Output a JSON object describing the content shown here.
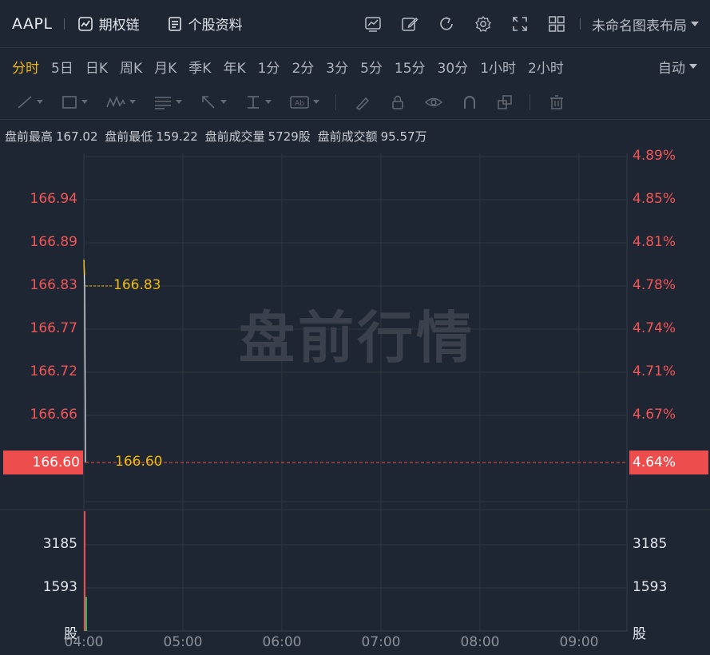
{
  "header": {
    "symbol": "AAPL",
    "options_chain": "期权链",
    "stock_profile": "个股资料",
    "layout_name": "未命名图表布局"
  },
  "periods": [
    "分时",
    "5日",
    "日K",
    "周K",
    "月K",
    "季K",
    "年K",
    "1分",
    "2分",
    "3分",
    "5分",
    "15分",
    "30分",
    "1小时",
    "2小时"
  ],
  "active_period": "分时",
  "auto_label": "自动",
  "premarket": {
    "high_label": "盘前最高",
    "high": "167.02",
    "low_label": "盘前最低",
    "low": "159.22",
    "vol_label": "盘前成交量",
    "vol": "5729股",
    "amt_label": "盘前成交额",
    "amt": "95.57万"
  },
  "watermark": "盘前行情",
  "price_axis": [
    "166.94",
    "166.89",
    "166.83",
    "166.77",
    "166.72",
    "166.66"
  ],
  "pct_axis": [
    "4.89%",
    "4.85%",
    "4.81%",
    "4.78%",
    "4.74%",
    "4.71%",
    "4.67%"
  ],
  "current_price": "166.60",
  "current_pct": "4.64%",
  "line_tag_high": "166.83",
  "line_tag_cur": "166.60",
  "volume_axis": [
    "3185",
    "1593"
  ],
  "volume_unit": "股",
  "time_axis": [
    "04:00",
    "05:00",
    "06:00",
    "07:00",
    "08:00",
    "09:00"
  ],
  "colors": {
    "up": "#f15656",
    "accent": "#f0b90b",
    "bg": "#1f2633",
    "grid": "#2c3540"
  }
}
